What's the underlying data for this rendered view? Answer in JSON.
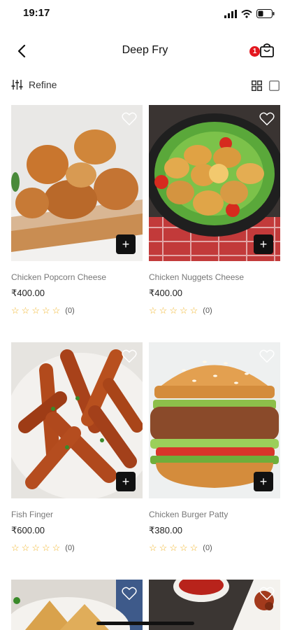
{
  "status_bar": {
    "time": "19:17"
  },
  "header": {
    "title": "Deep Fry",
    "cart_count": "1"
  },
  "toolbar": {
    "refine_label": "Refine"
  },
  "products": [
    {
      "name": "Chicken Popcorn Cheese",
      "price": "₹400.00",
      "reviews": "(0)",
      "image": "fried-chicken-on-board"
    },
    {
      "name": "Chicken Nuggets Cheese",
      "price": "₹400.00",
      "reviews": "(0)",
      "image": "nuggets-on-lettuce-pan"
    },
    {
      "name": "Fish Finger",
      "price": "₹600.00",
      "reviews": "(0)",
      "image": "fish-fingers"
    },
    {
      "name": "Chicken Burger Patty",
      "price": "₹380.00",
      "reviews": "(0)",
      "image": "chicken-burger"
    },
    {
      "name": "",
      "price": "",
      "reviews": "",
      "image": "samosas"
    },
    {
      "name": "",
      "price": "",
      "reviews": "",
      "image": "dip-bowl"
    }
  ],
  "colors": {
    "badge": "#e3171f",
    "star": "#f0b429",
    "add_button": "#111111"
  },
  "icons": {
    "back": "chevron-left-icon",
    "cart": "shopping-bag-icon",
    "refine": "sliders-icon",
    "grid": "grid-view-icon",
    "single": "single-view-icon",
    "favorite": "heart-icon",
    "add": "plus-icon"
  }
}
